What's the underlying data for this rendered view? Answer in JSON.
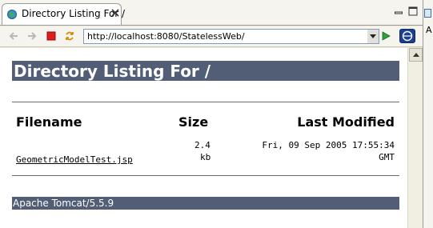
{
  "tab": {
    "title": "Directory Listing For /"
  },
  "toolbar": {
    "url": "http://localhost:8080/StatelessWeb/"
  },
  "side_panel": {
    "letter": "A"
  },
  "page": {
    "heading": "Directory Listing For /",
    "columns": {
      "filename": "Filename",
      "size": "Size",
      "modified": "Last Modified"
    },
    "rows": [
      {
        "filename": "GeometricModelTest.jsp",
        "size_value": "2.4",
        "size_unit": "kb",
        "modified": "Fri, 09 Sep 2005 17:55:34",
        "modified_tz": "GMT"
      }
    ],
    "footer": "Apache Tomcat/5.5.9"
  },
  "colors": {
    "header_bar": "#525d76",
    "stop_button": "#e21b1b",
    "go_button": "#2aa33a"
  }
}
